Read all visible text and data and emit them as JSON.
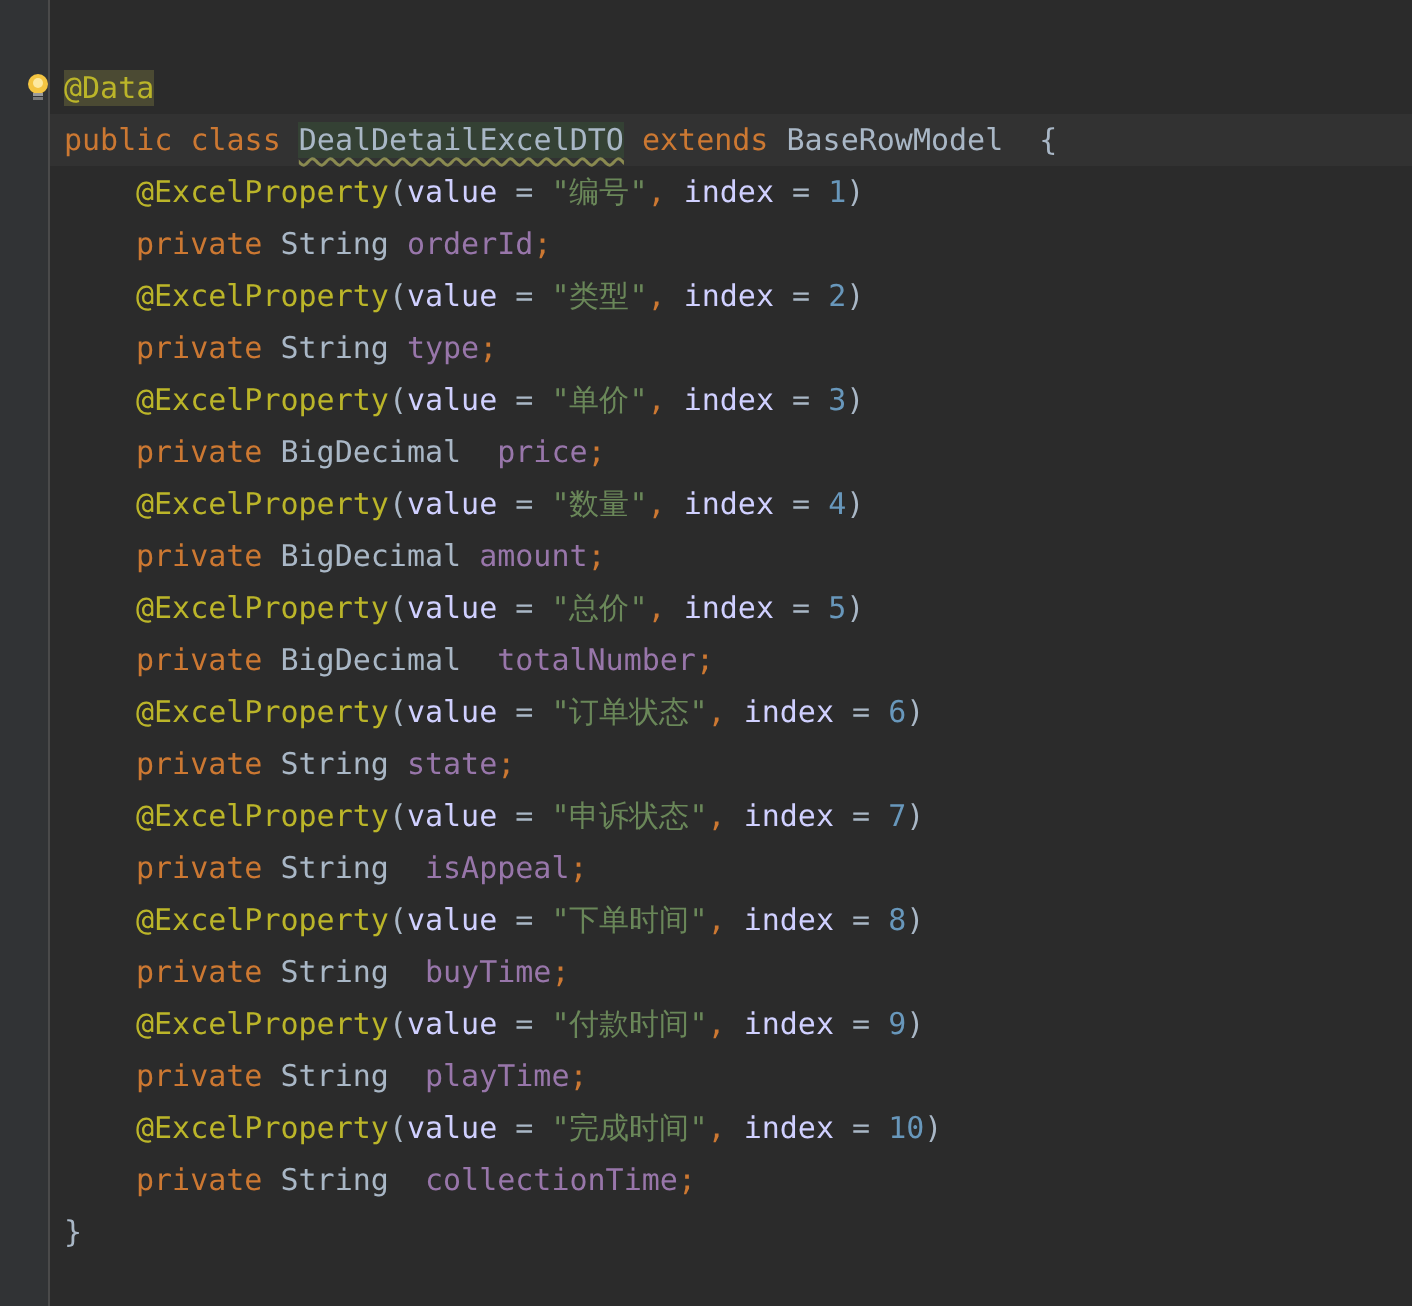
{
  "editor": {
    "lines": [
      {
        "bulb": true,
        "tokens": [
          {
            "kind": "annotation",
            "text": "@Data",
            "highlighted": true
          }
        ]
      },
      {
        "current": true,
        "tokens": [
          {
            "kind": "keyword",
            "text": "public class "
          },
          {
            "kind": "type",
            "text": "DealDetailExcelDTO",
            "warning": true
          },
          {
            "kind": "keyword",
            "text": " extends"
          },
          {
            "kind": "plain",
            "text": " BaseRowModel  {"
          }
        ],
        "children": [
          {
            "tokens": [
              {
                "kind": "annotation",
                "text": "@ExcelProperty"
              },
              {
                "kind": "plain",
                "text": "("
              },
              {
                "kind": "param",
                "text": "value"
              },
              {
                "kind": "plain",
                "text": " = "
              },
              {
                "kind": "string",
                "text": "\"编号\""
              },
              {
                "kind": "keyword",
                "text": ", "
              },
              {
                "kind": "param",
                "text": "index"
              },
              {
                "kind": "plain",
                "text": " = "
              },
              {
                "kind": "number",
                "text": "1"
              },
              {
                "kind": "plain",
                "text": ")"
              }
            ]
          },
          {
            "tokens": [
              {
                "kind": "keyword",
                "text": "private"
              },
              {
                "kind": "plain",
                "text": " String "
              },
              {
                "kind": "field",
                "text": "orderId"
              },
              {
                "kind": "keyword",
                "text": ";"
              }
            ]
          },
          {
            "tokens": [
              {
                "kind": "annotation",
                "text": "@ExcelProperty"
              },
              {
                "kind": "plain",
                "text": "("
              },
              {
                "kind": "param",
                "text": "value"
              },
              {
                "kind": "plain",
                "text": " = "
              },
              {
                "kind": "string",
                "text": "\"类型\""
              },
              {
                "kind": "keyword",
                "text": ", "
              },
              {
                "kind": "param",
                "text": "index"
              },
              {
                "kind": "plain",
                "text": " = "
              },
              {
                "kind": "number",
                "text": "2"
              },
              {
                "kind": "plain",
                "text": ")"
              }
            ]
          },
          {
            "tokens": [
              {
                "kind": "keyword",
                "text": "private"
              },
              {
                "kind": "plain",
                "text": " String "
              },
              {
                "kind": "field",
                "text": "type"
              },
              {
                "kind": "keyword",
                "text": ";"
              }
            ]
          },
          {
            "tokens": [
              {
                "kind": "annotation",
                "text": "@ExcelProperty"
              },
              {
                "kind": "plain",
                "text": "("
              },
              {
                "kind": "param",
                "text": "value"
              },
              {
                "kind": "plain",
                "text": " = "
              },
              {
                "kind": "string",
                "text": "\"单价\""
              },
              {
                "kind": "keyword",
                "text": ", "
              },
              {
                "kind": "param",
                "text": "index"
              },
              {
                "kind": "plain",
                "text": " = "
              },
              {
                "kind": "number",
                "text": "3"
              },
              {
                "kind": "plain",
                "text": ")"
              }
            ]
          },
          {
            "tokens": [
              {
                "kind": "keyword",
                "text": "private"
              },
              {
                "kind": "plain",
                "text": " BigDecimal  "
              },
              {
                "kind": "field",
                "text": "price"
              },
              {
                "kind": "keyword",
                "text": ";"
              }
            ]
          },
          {
            "tokens": [
              {
                "kind": "annotation",
                "text": "@ExcelProperty"
              },
              {
                "kind": "plain",
                "text": "("
              },
              {
                "kind": "param",
                "text": "value"
              },
              {
                "kind": "plain",
                "text": " = "
              },
              {
                "kind": "string",
                "text": "\"数量\""
              },
              {
                "kind": "keyword",
                "text": ", "
              },
              {
                "kind": "param",
                "text": "index"
              },
              {
                "kind": "plain",
                "text": " = "
              },
              {
                "kind": "number",
                "text": "4"
              },
              {
                "kind": "plain",
                "text": ")"
              }
            ]
          },
          {
            "tokens": [
              {
                "kind": "keyword",
                "text": "private"
              },
              {
                "kind": "plain",
                "text": " BigDecimal "
              },
              {
                "kind": "field",
                "text": "amount"
              },
              {
                "kind": "keyword",
                "text": ";"
              }
            ]
          },
          {
            "tokens": [
              {
                "kind": "annotation",
                "text": "@ExcelProperty"
              },
              {
                "kind": "plain",
                "text": "("
              },
              {
                "kind": "param",
                "text": "value"
              },
              {
                "kind": "plain",
                "text": " = "
              },
              {
                "kind": "string",
                "text": "\"总价\""
              },
              {
                "kind": "keyword",
                "text": ", "
              },
              {
                "kind": "param",
                "text": "index"
              },
              {
                "kind": "plain",
                "text": " = "
              },
              {
                "kind": "number",
                "text": "5"
              },
              {
                "kind": "plain",
                "text": ")"
              }
            ]
          },
          {
            "tokens": [
              {
                "kind": "keyword",
                "text": "private"
              },
              {
                "kind": "plain",
                "text": " BigDecimal  "
              },
              {
                "kind": "field",
                "text": "totalNumber"
              },
              {
                "kind": "keyword",
                "text": ";"
              }
            ]
          },
          {
            "tokens": [
              {
                "kind": "annotation",
                "text": "@ExcelProperty"
              },
              {
                "kind": "plain",
                "text": "("
              },
              {
                "kind": "param",
                "text": "value"
              },
              {
                "kind": "plain",
                "text": " = "
              },
              {
                "kind": "string",
                "text": "\"订单状态\""
              },
              {
                "kind": "keyword",
                "text": ", "
              },
              {
                "kind": "param",
                "text": "index"
              },
              {
                "kind": "plain",
                "text": " = "
              },
              {
                "kind": "number",
                "text": "6"
              },
              {
                "kind": "plain",
                "text": ")"
              }
            ]
          },
          {
            "tokens": [
              {
                "kind": "keyword",
                "text": "private"
              },
              {
                "kind": "plain",
                "text": " String "
              },
              {
                "kind": "field",
                "text": "state"
              },
              {
                "kind": "keyword",
                "text": ";"
              }
            ]
          },
          {
            "tokens": [
              {
                "kind": "annotation",
                "text": "@ExcelProperty"
              },
              {
                "kind": "plain",
                "text": "("
              },
              {
                "kind": "param",
                "text": "value"
              },
              {
                "kind": "plain",
                "text": " = "
              },
              {
                "kind": "string",
                "text": "\"申诉状态\""
              },
              {
                "kind": "keyword",
                "text": ", "
              },
              {
                "kind": "param",
                "text": "index"
              },
              {
                "kind": "plain",
                "text": " = "
              },
              {
                "kind": "number",
                "text": "7"
              },
              {
                "kind": "plain",
                "text": ")"
              }
            ]
          },
          {
            "tokens": [
              {
                "kind": "keyword",
                "text": "private"
              },
              {
                "kind": "plain",
                "text": " String  "
              },
              {
                "kind": "field",
                "text": "isAppeal"
              },
              {
                "kind": "keyword",
                "text": ";"
              }
            ]
          },
          {
            "tokens": [
              {
                "kind": "annotation",
                "text": "@ExcelProperty"
              },
              {
                "kind": "plain",
                "text": "("
              },
              {
                "kind": "param",
                "text": "value"
              },
              {
                "kind": "plain",
                "text": " = "
              },
              {
                "kind": "string",
                "text": "\"下单时间\""
              },
              {
                "kind": "keyword",
                "text": ", "
              },
              {
                "kind": "param",
                "text": "index"
              },
              {
                "kind": "plain",
                "text": " = "
              },
              {
                "kind": "number",
                "text": "8"
              },
              {
                "kind": "plain",
                "text": ")"
              }
            ]
          },
          {
            "tokens": [
              {
                "kind": "keyword",
                "text": "private"
              },
              {
                "kind": "plain",
                "text": " String  "
              },
              {
                "kind": "field",
                "text": "buyTime"
              },
              {
                "kind": "keyword",
                "text": ";"
              }
            ]
          },
          {
            "tokens": [
              {
                "kind": "annotation",
                "text": "@ExcelProperty"
              },
              {
                "kind": "plain",
                "text": "("
              },
              {
                "kind": "param",
                "text": "value"
              },
              {
                "kind": "plain",
                "text": " = "
              },
              {
                "kind": "string",
                "text": "\"付款时间\""
              },
              {
                "kind": "keyword",
                "text": ", "
              },
              {
                "kind": "param",
                "text": "index"
              },
              {
                "kind": "plain",
                "text": " = "
              },
              {
                "kind": "number",
                "text": "9"
              },
              {
                "kind": "plain",
                "text": ")"
              }
            ]
          },
          {
            "tokens": [
              {
                "kind": "keyword",
                "text": "private"
              },
              {
                "kind": "plain",
                "text": " String  "
              },
              {
                "kind": "field",
                "text": "playTime"
              },
              {
                "kind": "keyword",
                "text": ";"
              }
            ]
          },
          {
            "tokens": [
              {
                "kind": "annotation",
                "text": "@ExcelProperty"
              },
              {
                "kind": "plain",
                "text": "("
              },
              {
                "kind": "param",
                "text": "value"
              },
              {
                "kind": "plain",
                "text": " = "
              },
              {
                "kind": "string",
                "text": "\"完成时间\""
              },
              {
                "kind": "keyword",
                "text": ", "
              },
              {
                "kind": "param",
                "text": "index"
              },
              {
                "kind": "plain",
                "text": " = "
              },
              {
                "kind": "number",
                "text": "10"
              },
              {
                "kind": "plain",
                "text": ")"
              }
            ]
          },
          {
            "tokens": [
              {
                "kind": "keyword",
                "text": "private"
              },
              {
                "kind": "plain",
                "text": " String  "
              },
              {
                "kind": "field",
                "text": "collectionTime"
              },
              {
                "kind": "keyword",
                "text": ";"
              }
            ]
          }
        ]
      },
      {
        "tokens": [
          {
            "kind": "plain",
            "text": "}"
          }
        ]
      }
    ]
  }
}
